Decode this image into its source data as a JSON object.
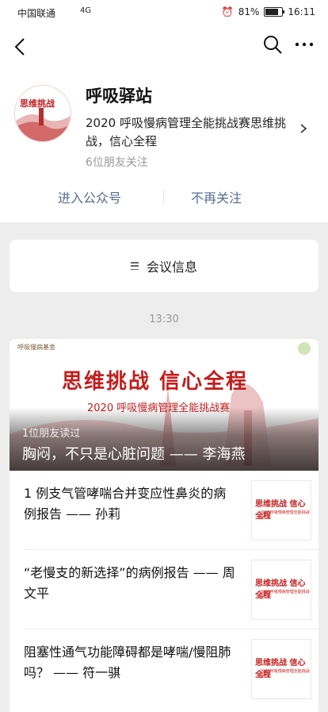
{
  "status": {
    "carrier": "中国联通",
    "signal_text": "4G",
    "battery": "81%",
    "battery_level": 0.81,
    "time": "16:11"
  },
  "account": {
    "name": "呼吸驿站",
    "description": "2020 呼吸慢病管理全能挑战赛思维挑战，信心全程",
    "followers": "6位朋友关注",
    "enter_label": "进入公众号",
    "unfollow_label": "不再关注"
  },
  "meeting": {
    "label": "会议信息"
  },
  "timestamp": "13:30",
  "cover": {
    "org": "呼吸慢病基金",
    "headline": "思维挑战 信心全程",
    "subheadline": "2020 呼吸慢病管理全能挑战赛",
    "read_by": "1位朋友读过",
    "title": "胸闷，不只是心脏问题 —— 李海燕"
  },
  "articles": [
    {
      "title": "1 例支气管哮喘合并变应性鼻炎的病例报告 —— 孙莉"
    },
    {
      "title": "“老慢支的新选择”的病例报告 —— 周文平"
    },
    {
      "title": "阻塞性通气功能障碍都是哮喘/慢阻肺吗？ —— 符一骐"
    }
  ],
  "thumb": {
    "headline": "思维挑战 信心全程",
    "sub": "2020呼吸慢病管理全能挑战赛"
  },
  "colors": {
    "link": "#576b95",
    "accent_red": "#c41d1d",
    "background": "#ededed"
  }
}
